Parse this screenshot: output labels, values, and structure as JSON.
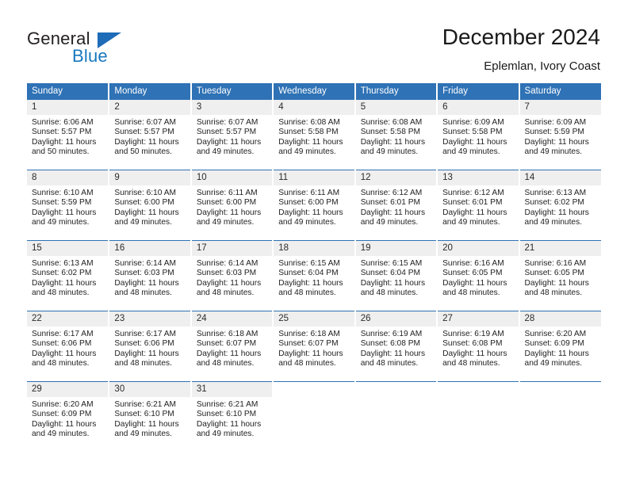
{
  "brand": {
    "name_part1": "General",
    "name_part2": "Blue",
    "triangle_icon": "triangle-icon",
    "colors": {
      "dark": "#231f20",
      "blue": "#1878be"
    }
  },
  "header": {
    "title": "December 2024",
    "subtitle": "Eplemlan, Ivory Coast"
  },
  "theme": {
    "header_blue": "#2f72b5",
    "daynum_gray": "#efefef",
    "text": "#222222"
  },
  "calendar": {
    "weekdays": [
      "Sunday",
      "Monday",
      "Tuesday",
      "Wednesday",
      "Thursday",
      "Friday",
      "Saturday"
    ],
    "weeks": [
      [
        {
          "day": "1",
          "sunrise": "Sunrise: 6:06 AM",
          "sunset": "Sunset: 5:57 PM",
          "daylight_l1": "Daylight: 11 hours",
          "daylight_l2": "and 50 minutes."
        },
        {
          "day": "2",
          "sunrise": "Sunrise: 6:07 AM",
          "sunset": "Sunset: 5:57 PM",
          "daylight_l1": "Daylight: 11 hours",
          "daylight_l2": "and 50 minutes."
        },
        {
          "day": "3",
          "sunrise": "Sunrise: 6:07 AM",
          "sunset": "Sunset: 5:57 PM",
          "daylight_l1": "Daylight: 11 hours",
          "daylight_l2": "and 49 minutes."
        },
        {
          "day": "4",
          "sunrise": "Sunrise: 6:08 AM",
          "sunset": "Sunset: 5:58 PM",
          "daylight_l1": "Daylight: 11 hours",
          "daylight_l2": "and 49 minutes."
        },
        {
          "day": "5",
          "sunrise": "Sunrise: 6:08 AM",
          "sunset": "Sunset: 5:58 PM",
          "daylight_l1": "Daylight: 11 hours",
          "daylight_l2": "and 49 minutes."
        },
        {
          "day": "6",
          "sunrise": "Sunrise: 6:09 AM",
          "sunset": "Sunset: 5:58 PM",
          "daylight_l1": "Daylight: 11 hours",
          "daylight_l2": "and 49 minutes."
        },
        {
          "day": "7",
          "sunrise": "Sunrise: 6:09 AM",
          "sunset": "Sunset: 5:59 PM",
          "daylight_l1": "Daylight: 11 hours",
          "daylight_l2": "and 49 minutes."
        }
      ],
      [
        {
          "day": "8",
          "sunrise": "Sunrise: 6:10 AM",
          "sunset": "Sunset: 5:59 PM",
          "daylight_l1": "Daylight: 11 hours",
          "daylight_l2": "and 49 minutes."
        },
        {
          "day": "9",
          "sunrise": "Sunrise: 6:10 AM",
          "sunset": "Sunset: 6:00 PM",
          "daylight_l1": "Daylight: 11 hours",
          "daylight_l2": "and 49 minutes."
        },
        {
          "day": "10",
          "sunrise": "Sunrise: 6:11 AM",
          "sunset": "Sunset: 6:00 PM",
          "daylight_l1": "Daylight: 11 hours",
          "daylight_l2": "and 49 minutes."
        },
        {
          "day": "11",
          "sunrise": "Sunrise: 6:11 AM",
          "sunset": "Sunset: 6:00 PM",
          "daylight_l1": "Daylight: 11 hours",
          "daylight_l2": "and 49 minutes."
        },
        {
          "day": "12",
          "sunrise": "Sunrise: 6:12 AM",
          "sunset": "Sunset: 6:01 PM",
          "daylight_l1": "Daylight: 11 hours",
          "daylight_l2": "and 49 minutes."
        },
        {
          "day": "13",
          "sunrise": "Sunrise: 6:12 AM",
          "sunset": "Sunset: 6:01 PM",
          "daylight_l1": "Daylight: 11 hours",
          "daylight_l2": "and 49 minutes."
        },
        {
          "day": "14",
          "sunrise": "Sunrise: 6:13 AM",
          "sunset": "Sunset: 6:02 PM",
          "daylight_l1": "Daylight: 11 hours",
          "daylight_l2": "and 49 minutes."
        }
      ],
      [
        {
          "day": "15",
          "sunrise": "Sunrise: 6:13 AM",
          "sunset": "Sunset: 6:02 PM",
          "daylight_l1": "Daylight: 11 hours",
          "daylight_l2": "and 48 minutes."
        },
        {
          "day": "16",
          "sunrise": "Sunrise: 6:14 AM",
          "sunset": "Sunset: 6:03 PM",
          "daylight_l1": "Daylight: 11 hours",
          "daylight_l2": "and 48 minutes."
        },
        {
          "day": "17",
          "sunrise": "Sunrise: 6:14 AM",
          "sunset": "Sunset: 6:03 PM",
          "daylight_l1": "Daylight: 11 hours",
          "daylight_l2": "and 48 minutes."
        },
        {
          "day": "18",
          "sunrise": "Sunrise: 6:15 AM",
          "sunset": "Sunset: 6:04 PM",
          "daylight_l1": "Daylight: 11 hours",
          "daylight_l2": "and 48 minutes."
        },
        {
          "day": "19",
          "sunrise": "Sunrise: 6:15 AM",
          "sunset": "Sunset: 6:04 PM",
          "daylight_l1": "Daylight: 11 hours",
          "daylight_l2": "and 48 minutes."
        },
        {
          "day": "20",
          "sunrise": "Sunrise: 6:16 AM",
          "sunset": "Sunset: 6:05 PM",
          "daylight_l1": "Daylight: 11 hours",
          "daylight_l2": "and 48 minutes."
        },
        {
          "day": "21",
          "sunrise": "Sunrise: 6:16 AM",
          "sunset": "Sunset: 6:05 PM",
          "daylight_l1": "Daylight: 11 hours",
          "daylight_l2": "and 48 minutes."
        }
      ],
      [
        {
          "day": "22",
          "sunrise": "Sunrise: 6:17 AM",
          "sunset": "Sunset: 6:06 PM",
          "daylight_l1": "Daylight: 11 hours",
          "daylight_l2": "and 48 minutes."
        },
        {
          "day": "23",
          "sunrise": "Sunrise: 6:17 AM",
          "sunset": "Sunset: 6:06 PM",
          "daylight_l1": "Daylight: 11 hours",
          "daylight_l2": "and 48 minutes."
        },
        {
          "day": "24",
          "sunrise": "Sunrise: 6:18 AM",
          "sunset": "Sunset: 6:07 PM",
          "daylight_l1": "Daylight: 11 hours",
          "daylight_l2": "and 48 minutes."
        },
        {
          "day": "25",
          "sunrise": "Sunrise: 6:18 AM",
          "sunset": "Sunset: 6:07 PM",
          "daylight_l1": "Daylight: 11 hours",
          "daylight_l2": "and 48 minutes."
        },
        {
          "day": "26",
          "sunrise": "Sunrise: 6:19 AM",
          "sunset": "Sunset: 6:08 PM",
          "daylight_l1": "Daylight: 11 hours",
          "daylight_l2": "and 48 minutes."
        },
        {
          "day": "27",
          "sunrise": "Sunrise: 6:19 AM",
          "sunset": "Sunset: 6:08 PM",
          "daylight_l1": "Daylight: 11 hours",
          "daylight_l2": "and 48 minutes."
        },
        {
          "day": "28",
          "sunrise": "Sunrise: 6:20 AM",
          "sunset": "Sunset: 6:09 PM",
          "daylight_l1": "Daylight: 11 hours",
          "daylight_l2": "and 49 minutes."
        }
      ],
      [
        {
          "day": "29",
          "sunrise": "Sunrise: 6:20 AM",
          "sunset": "Sunset: 6:09 PM",
          "daylight_l1": "Daylight: 11 hours",
          "daylight_l2": "and 49 minutes."
        },
        {
          "day": "30",
          "sunrise": "Sunrise: 6:21 AM",
          "sunset": "Sunset: 6:10 PM",
          "daylight_l1": "Daylight: 11 hours",
          "daylight_l2": "and 49 minutes."
        },
        {
          "day": "31",
          "sunrise": "Sunrise: 6:21 AM",
          "sunset": "Sunset: 6:10 PM",
          "daylight_l1": "Daylight: 11 hours",
          "daylight_l2": "and 49 minutes."
        },
        {
          "day": "",
          "sunrise": "",
          "sunset": "",
          "daylight_l1": "",
          "daylight_l2": ""
        },
        {
          "day": "",
          "sunrise": "",
          "sunset": "",
          "daylight_l1": "",
          "daylight_l2": ""
        },
        {
          "day": "",
          "sunrise": "",
          "sunset": "",
          "daylight_l1": "",
          "daylight_l2": ""
        },
        {
          "day": "",
          "sunrise": "",
          "sunset": "",
          "daylight_l1": "",
          "daylight_l2": ""
        }
      ]
    ]
  }
}
